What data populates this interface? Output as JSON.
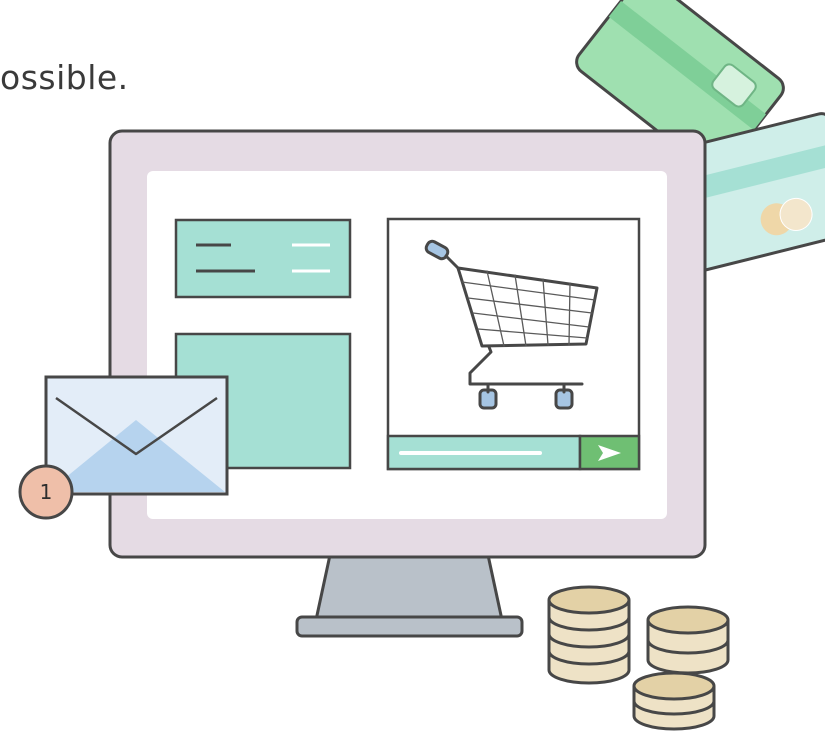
{
  "headline": "ossible.",
  "notification": {
    "count": "1"
  },
  "colors": {
    "outline": "#474747",
    "monitor_frame": "#e5dbe4",
    "teal": "#a5e0d4",
    "green_button": "#6fbf73",
    "card_green": "#9fe0b0",
    "card_mint": "#cfeee9",
    "envelope": "#e3edf8",
    "envelope_flap": "#b6d3ee",
    "badge": "#efbfa9",
    "coin": "#eee2c6",
    "stand": "#b9c1c9",
    "cart_handle": "#a6c5e3"
  },
  "icons": [
    "shopping-cart-icon",
    "send-arrow-icon",
    "envelope-icon",
    "credit-card-icon",
    "coin-stack-icon"
  ]
}
